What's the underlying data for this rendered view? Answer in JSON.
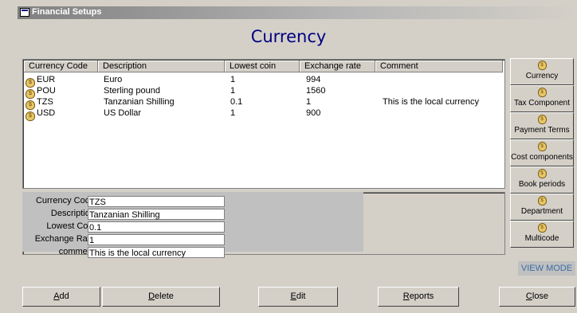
{
  "window": {
    "title": "Financial Setups",
    "icon": "form-icon"
  },
  "heading": "Currency",
  "table": {
    "columns": [
      "Currency Code",
      "Description",
      "Lowest coin",
      "Exchange rate",
      "Comment"
    ],
    "rows": [
      {
        "code": "EUR",
        "description": "Euro",
        "lowest": "1",
        "rate": "994",
        "comment": ""
      },
      {
        "code": "POU",
        "description": "Sterling pound",
        "lowest": "1",
        "rate": "1560",
        "comment": ""
      },
      {
        "code": "TZS",
        "description": "Tanzanian Shilling",
        "lowest": "0.1",
        "rate": "1",
        "comment": "This is the local currency"
      },
      {
        "code": "USD",
        "description": "US Dollar",
        "lowest": "1",
        "rate": "900",
        "comment": ""
      }
    ],
    "row_icon": "money-bag-icon"
  },
  "form": {
    "labels": {
      "code": "Currency Code:",
      "description": "Description:",
      "lowest": "Lowest Coin:",
      "rate": "Exchange Rate:",
      "comment": "comment:"
    },
    "values": {
      "code": "TZS",
      "description": "Tanzanian Shilling",
      "lowest": "0.1",
      "rate": "1",
      "comment": "This is the local currency"
    }
  },
  "sidebar": {
    "items": [
      {
        "label": "Currency",
        "icon": "money-bag-icon"
      },
      {
        "label": "Tax Component",
        "icon": "money-bag-icon"
      },
      {
        "label": "Payment Terms",
        "icon": "money-bag-icon"
      },
      {
        "label": "Cost components",
        "icon": "money-bag-icon"
      },
      {
        "label": "Book periods",
        "icon": "money-bag-icon"
      },
      {
        "label": "Department",
        "icon": "money-bag-icon"
      },
      {
        "label": "Multicode",
        "icon": "money-bag-icon"
      }
    ],
    "mode": "VIEW MODE"
  },
  "buttons": {
    "add": {
      "accel": "A",
      "rest": "dd"
    },
    "delete": {
      "accel": "D",
      "rest": "elete"
    },
    "edit": {
      "accel": "E",
      "rest": "dit"
    },
    "reports": {
      "accel": "R",
      "rest": "eports"
    },
    "close": {
      "accel": "C",
      "rest": "lose"
    }
  },
  "colors": {
    "heading": "#000080",
    "view_mode": "#3a6ea5",
    "background": "#d4d0c8"
  }
}
